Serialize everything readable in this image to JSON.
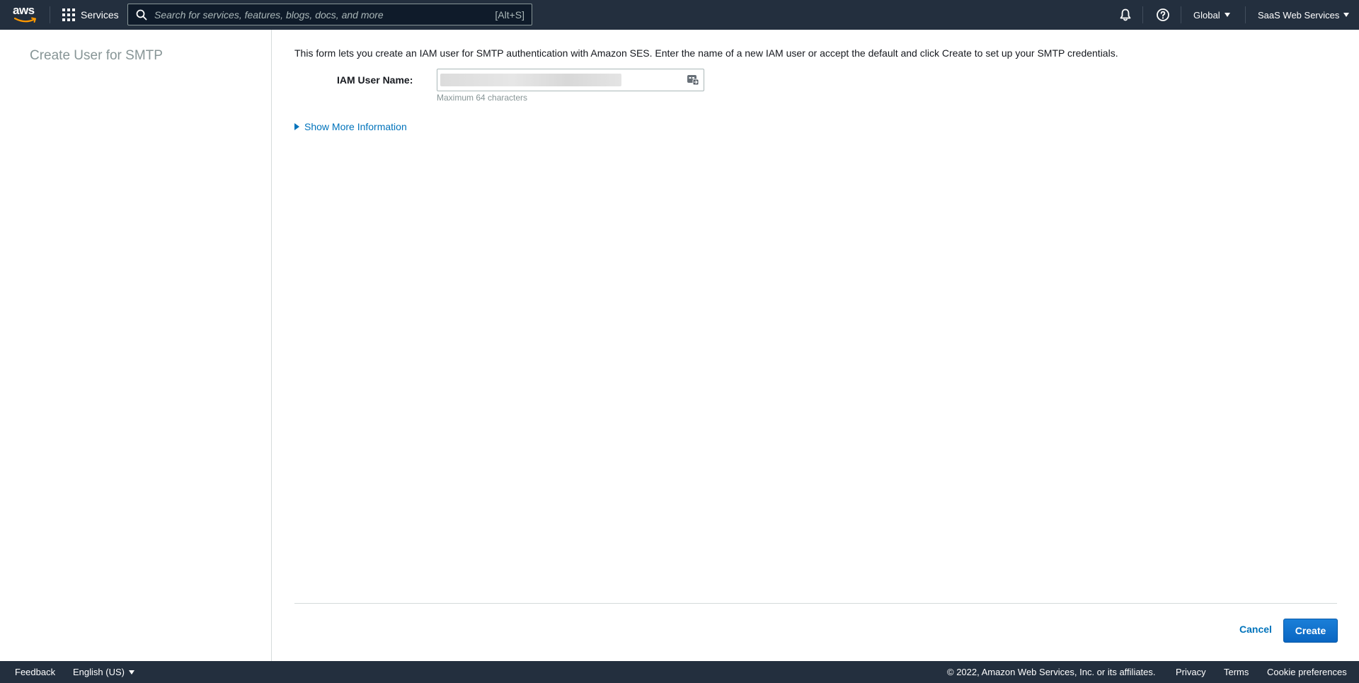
{
  "topnav": {
    "logo": "aws",
    "services_label": "Services",
    "search_placeholder": "Search for services, features, blogs, docs, and more",
    "search_shortcut": "[Alt+S]",
    "region_label": "Global",
    "account_label": "SaaS Web Services",
    "icons": [
      "bell-icon",
      "help-icon"
    ]
  },
  "sidebar": {
    "title": "Create User for SMTP"
  },
  "form": {
    "intro": "This form lets you create an IAM user for SMTP authentication with Amazon SES. Enter the name of a new IAM user or accept the default and click Create to set up your SMTP credentials.",
    "iam_label": "IAM User Name:",
    "iam_value": "",
    "iam_hint": "Maximum 64 characters",
    "show_more": "Show More Information",
    "cancel_label": "Cancel",
    "create_label": "Create"
  },
  "footer": {
    "feedback": "Feedback",
    "language": "English (US)",
    "copyright": "© 2022, Amazon Web Services, Inc. or its affiliates.",
    "privacy": "Privacy",
    "terms": "Terms",
    "cookies": "Cookie preferences"
  },
  "colors": {
    "nav_bg": "#232f3e",
    "link": "#0073bb",
    "primary_button": "#0972d3"
  }
}
